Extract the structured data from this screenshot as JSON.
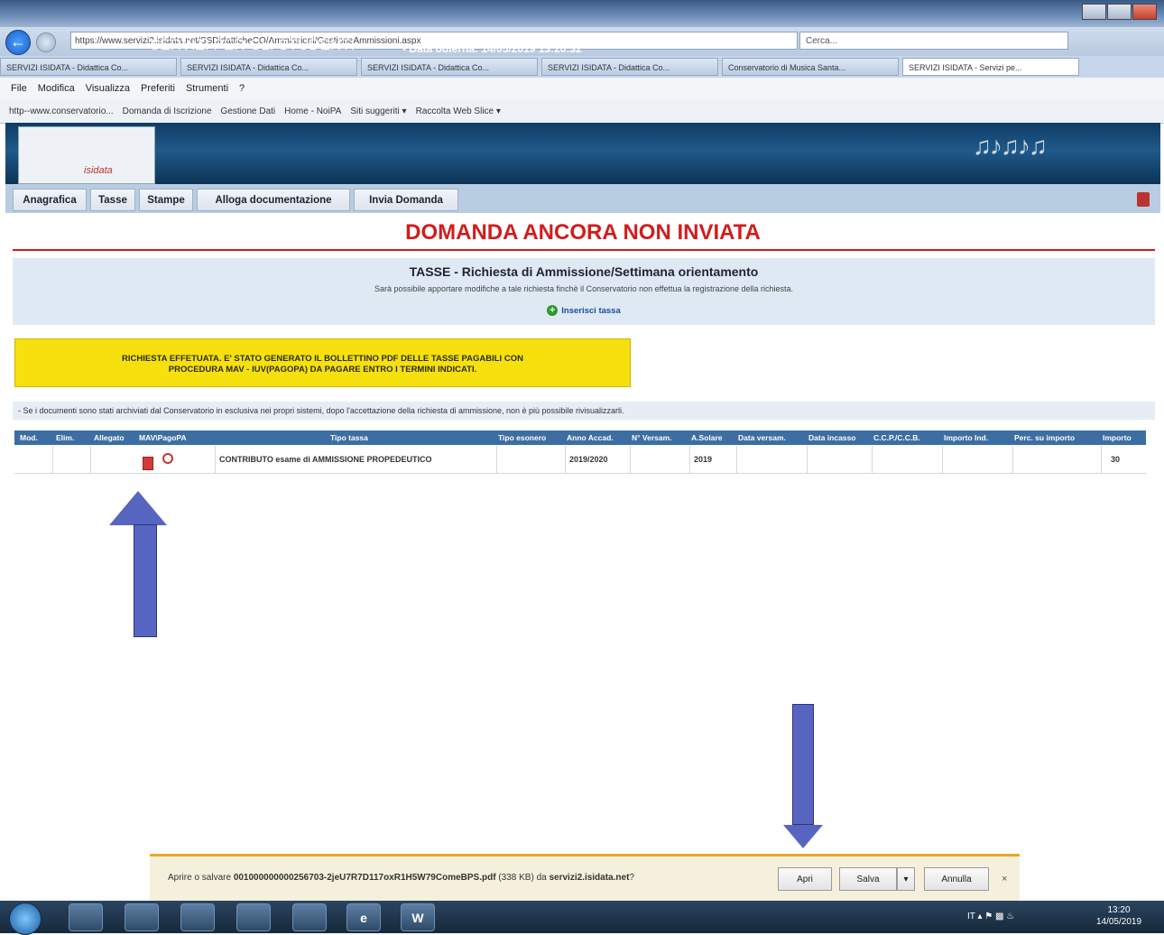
{
  "browser": {
    "url": "https://www.servizi2.isidata.net/SSDidatticheCO/Ammissioni/GestioneAmmissioni.aspx",
    "search_placeholder": "Cerca...",
    "tabs": [
      {
        "label": "SERVIZI ISIDATA - Didattica Co..."
      },
      {
        "label": "SERVIZI ISIDATA - Didattica Co..."
      },
      {
        "label": "SERVIZI ISIDATA - Didattica Co..."
      },
      {
        "label": "SERVIZI ISIDATA - Didattica Co..."
      },
      {
        "label": "Conservatorio di Musica Santa..."
      },
      {
        "label": "SERVIZI ISIDATA - Servizi pe..."
      }
    ],
    "menu": [
      "File",
      "Modifica",
      "Visualizza",
      "Preferiti",
      "Strumenti",
      "?"
    ],
    "favorites": [
      "http--www.conservatorio...",
      "Domanda di Iscrizione",
      "Gestione Dati",
      "Home - NoiPA",
      "Siti suggeriti ▾",
      "Raccolta Web Slice ▾"
    ]
  },
  "header": {
    "logo_text": "isidata",
    "title": "SERVIZI PER GLI STUDENTI",
    "date": "- Data odierna: 14/05/2019 13:20:32"
  },
  "nav": {
    "tabs": [
      "Anagrafica",
      "Tasse",
      "Stampe",
      "Alloga documentazione",
      "Invia Domanda"
    ]
  },
  "page": {
    "status_title": "DOMANDA ANCORA NON INVIATA",
    "section_title": "TASSE - Richiesta di Ammissione/Settimana orientamento",
    "section_note": "Sarà possibile apportare modifiche a tale richiesta finchè il Conservatorio non effettua la registrazione della richiesta.",
    "insert_link": "Inserisci tassa",
    "yellow_line1": "RICHIESTA EFFETUATA. E' STATO GENERATO IL BOLLETTINO PDF DELLE TASSE PAGABILI CON",
    "yellow_line2": "PROCEDURA MAV - IUV(PAGOPA) DA PAGARE ENTRO I TERMINI INDICATI.",
    "notice": "- Se i documenti sono stati archiviati dal Conservatorio in esclusiva nei propri sistemi, dopo l'accettazione della richiesta di ammissione, non è più possibile rivisualizzarli."
  },
  "table": {
    "headers": {
      "mod": "Mod.",
      "elim": "Elim.",
      "allegato": "Allegato",
      "mav": "MAV\\PagoPA",
      "tipo_tassa": "Tipo tassa",
      "tipo_esonero": "Tipo esonero",
      "anno_accad": "Anno Accad.",
      "n_versam": "N° Versam.",
      "a_solare": "A.Solare",
      "data_versam": "Data versam.",
      "data_incasso": "Data incasso",
      "ccp": "C.C.P./C.C.B.",
      "importo_ind": "Importo Ind.",
      "perc": "Perc. su importo",
      "importo": "Importo"
    },
    "row": {
      "tipo_tassa": "CONTRIBUTO esame di AMMISSIONE PROPEDEUTICO",
      "anno_accad": "2019/2020",
      "a_solare": "2019",
      "importo": "30"
    }
  },
  "download": {
    "prefix": "Aprire o salvare ",
    "filename": "001000000000256703-2jeU7R7D117oxR1H5W79ComeBPS.pdf",
    "size": " (338 KB) da ",
    "host": "servizi2.isidata.net",
    "suffix": "?",
    "open": "Apri",
    "save": "Salva",
    "cancel": "Annulla",
    "close": "×"
  },
  "taskbar": {
    "lang": "IT",
    "time": "13:20",
    "date": "14/05/2019"
  },
  "colors": {
    "status_red": "#d21c1c",
    "header_blue": "#1f5a8a",
    "table_header": "#3c6ea3",
    "notice_yellow": "#f6e00d",
    "arrow": "#5865c0"
  }
}
